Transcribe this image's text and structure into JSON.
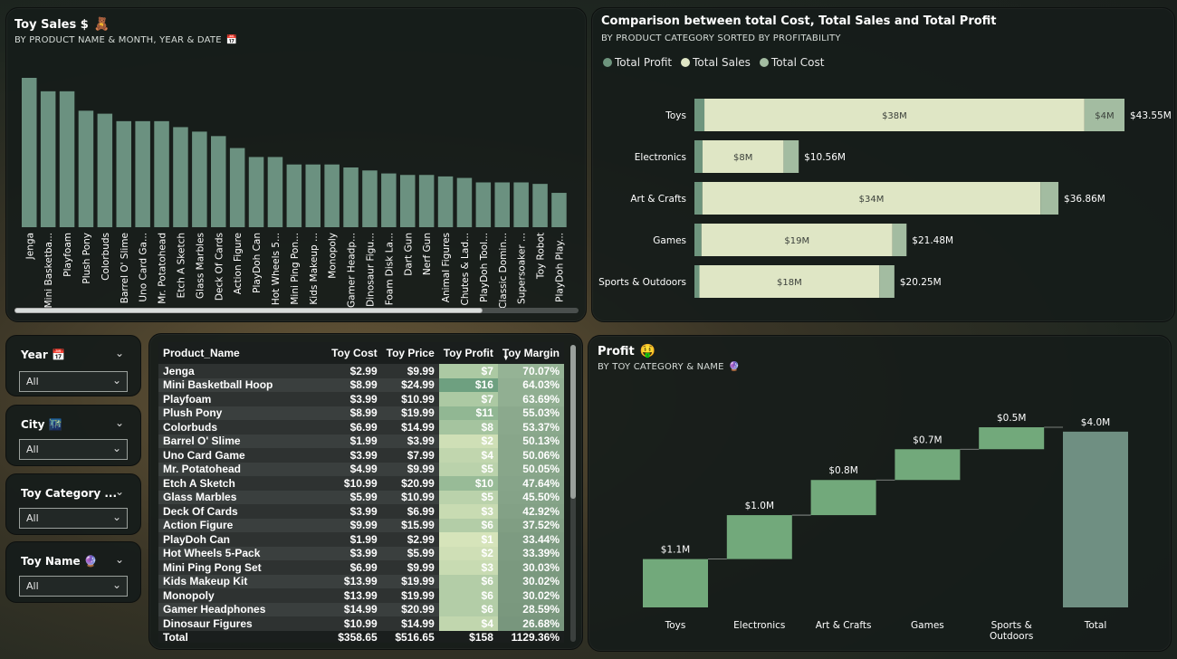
{
  "colors": {
    "bar": "#6b9180",
    "profit": "#6e957e",
    "sales": "#dfe6c5",
    "cost": "#a3bca1",
    "waterfall_up": "#72a97b",
    "waterfall_total": "#6f8f82"
  },
  "toy_sales": {
    "title": "Toy Sales $",
    "title_icon": "teddy-bear-icon",
    "subtitle": "BY PRODUCT NAME & MONTH, YEAR & DATE",
    "subtitle_icon": "calendar-icon"
  },
  "comparison": {
    "title": "Comparison between total Cost, Total Sales and Total Profit",
    "subtitle": "BY PRODUCT CATEGORY SORTED BY PROFITABILITY"
  },
  "profit": {
    "title": "Profit",
    "title_icon": "money-face-icon",
    "subtitle": "BY TOY CATEGORY & NAME",
    "subtitle_icon": "purple-orb-icon"
  },
  "slicers": [
    {
      "label": "Year",
      "icon": "calendar-icon",
      "value": "All"
    },
    {
      "label": "City",
      "icon": "city-icon",
      "value": "All"
    },
    {
      "label": "Toy Category ...",
      "icon": "",
      "value": "All"
    },
    {
      "label": "Toy Name",
      "icon": "purple-orb-icon",
      "value": "All"
    }
  ],
  "table": {
    "columns": [
      "Product_Name",
      "Toy Cost",
      "Toy Price",
      "Toy Profit",
      "Toy Margin"
    ],
    "sort_indicator": "sort-desc-icon",
    "rows": [
      [
        "Jenga",
        "$2.99",
        "$9.99",
        "$7",
        "70.07%"
      ],
      [
        "Mini Basketball Hoop",
        "$8.99",
        "$24.99",
        "$16",
        "64.03%"
      ],
      [
        "Playfoam",
        "$3.99",
        "$10.99",
        "$7",
        "63.69%"
      ],
      [
        "Plush Pony",
        "$8.99",
        "$19.99",
        "$11",
        "55.03%"
      ],
      [
        "Colorbuds",
        "$6.99",
        "$14.99",
        "$8",
        "53.37%"
      ],
      [
        "Barrel O' Slime",
        "$1.99",
        "$3.99",
        "$2",
        "50.13%"
      ],
      [
        "Uno Card Game",
        "$3.99",
        "$7.99",
        "$4",
        "50.06%"
      ],
      [
        "Mr. Potatohead",
        "$4.99",
        "$9.99",
        "$5",
        "50.05%"
      ],
      [
        "Etch A Sketch",
        "$10.99",
        "$20.99",
        "$10",
        "47.64%"
      ],
      [
        "Glass Marbles",
        "$5.99",
        "$10.99",
        "$5",
        "45.50%"
      ],
      [
        "Deck Of Cards",
        "$3.99",
        "$6.99",
        "$3",
        "42.92%"
      ],
      [
        "Action Figure",
        "$9.99",
        "$15.99",
        "$6",
        "37.52%"
      ],
      [
        "PlayDoh Can",
        "$1.99",
        "$2.99",
        "$1",
        "33.44%"
      ],
      [
        "Hot Wheels 5-Pack",
        "$3.99",
        "$5.99",
        "$2",
        "33.39%"
      ],
      [
        "Mini Ping Pong Set",
        "$6.99",
        "$9.99",
        "$3",
        "30.03%"
      ],
      [
        "Kids Makeup Kit",
        "$13.99",
        "$19.99",
        "$6",
        "30.02%"
      ],
      [
        "Monopoly",
        "$13.99",
        "$19.99",
        "$6",
        "30.02%"
      ],
      [
        "Gamer Headphones",
        "$14.99",
        "$20.99",
        "$6",
        "28.59%"
      ],
      [
        "Dinosaur Figures",
        "$10.99",
        "$14.99",
        "$4",
        "26.68%"
      ]
    ],
    "profit_values": [
      7,
      16,
      7,
      11,
      8,
      2,
      4,
      5,
      10,
      5,
      3,
      6,
      1,
      2,
      3,
      6,
      6,
      6,
      4
    ],
    "margin_values": [
      70.07,
      64.03,
      63.69,
      55.03,
      53.37,
      50.13,
      50.06,
      50.05,
      47.64,
      45.5,
      42.92,
      37.52,
      33.44,
      33.39,
      30.03,
      30.02,
      30.02,
      28.59,
      26.68
    ],
    "total": [
      "Total",
      "$358.65",
      "$516.65",
      "$158",
      "1129.36%"
    ]
  },
  "chart_data": [
    {
      "type": "bar",
      "categories": [
        "Jenga",
        "Mini Basketba...",
        "Playfoam",
        "Plush Pony",
        "Colorbuds",
        "Barrel O' Slime",
        "Uno Card Ga...",
        "Mr. Potatohead",
        "Etch A Sketch",
        "Glass Marbles",
        "Deck Of Cards",
        "Action Figure",
        "PlayDoh Can",
        "Hot Wheels 5...",
        "Mini Ping Pon...",
        "Kids Makeup ...",
        "Monopoly",
        "Gamer Headp...",
        "Dinosaur Figu...",
        "Foam Disk La...",
        "Dart Gun",
        "Nerf Gun",
        "Animal Figures",
        "Chutes & Lad...",
        "PlayDoh Tool...",
        "Classic Domin...",
        "Supersoaker ...",
        "Toy Robot",
        "PlayDoh Play..."
      ],
      "values": [
        100,
        91,
        91,
        78,
        76,
        71,
        71,
        71,
        67,
        64,
        61,
        53,
        47,
        47,
        42,
        42,
        42,
        40,
        38,
        36,
        35,
        35,
        34,
        33,
        30,
        30,
        30,
        29,
        23
      ],
      "ylim": [
        0,
        100
      ],
      "grid": false
    },
    {
      "type": "bar",
      "orientation": "horizontal",
      "stacked": true,
      "categories": [
        "Toys",
        "Electronics",
        "Art & Crafts",
        "Games",
        "Sports & Outdoors"
      ],
      "legend": [
        "Total Profit",
        "Total Sales",
        "Total Cost"
      ],
      "legend_position": "top-left",
      "series": [
        {
          "name": "Total Profit",
          "values": [
            1,
            0.8,
            0.8,
            0.7,
            0.5
          ]
        },
        {
          "name": "Total Sales",
          "values": [
            38,
            8,
            34,
            19,
            18
          ]
        },
        {
          "name": "Total Cost",
          "values": [
            4,
            1.5,
            1.8,
            1.4,
            1.5
          ]
        }
      ],
      "sales_labels": [
        "$38M",
        "$8M",
        "$34M",
        "$19M",
        "$18M"
      ],
      "cost_labels": [
        "$4M",
        "",
        "",
        "",
        ""
      ],
      "total_labels": [
        "$43.55M",
        "$10.56M",
        "$36.86M",
        "$21.48M",
        "$20.25M"
      ],
      "totals": [
        43.55,
        10.56,
        36.86,
        21.48,
        20.25
      ],
      "xlim": [
        0,
        43.55
      ]
    },
    {
      "type": "waterfall",
      "categories": [
        "Toys",
        "Electronics",
        "Art & Crafts",
        "Games",
        "Sports & Outdoors",
        "Total"
      ],
      "values": [
        1.1,
        1.0,
        0.8,
        0.7,
        0.5,
        4.0
      ],
      "labels": [
        "$1.1M",
        "$1.0M",
        "$0.8M",
        "$0.7M",
        "$0.5M",
        "$4.0M"
      ],
      "ylim": [
        0,
        4.1
      ]
    }
  ]
}
